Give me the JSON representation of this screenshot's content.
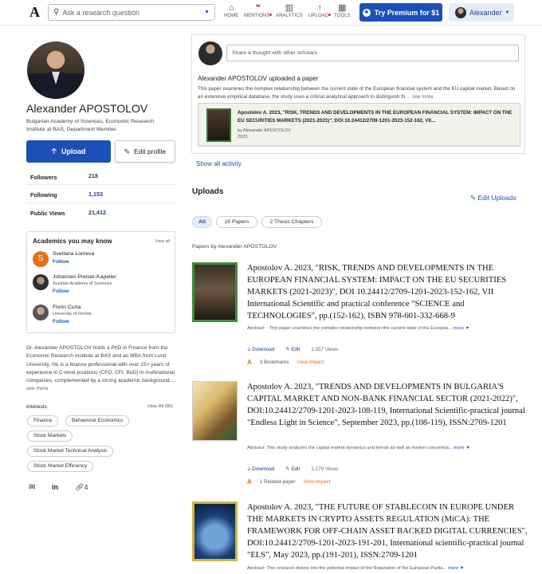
{
  "header": {
    "logo": "A",
    "search_placeholder": "Ask a research question",
    "nav": [
      {
        "label": "HOME",
        "icon": "home-icon",
        "glyph": "⌂"
      },
      {
        "label": "MENTIONS",
        "icon": "mentions-icon",
        "glyph": "❝"
      },
      {
        "label": "ANALYTICS",
        "icon": "analytics-icon",
        "glyph": "▥"
      },
      {
        "label": "UPLOAD",
        "icon": "upload-icon",
        "glyph": "↑"
      },
      {
        "label": "TOOLS",
        "icon": "tools-icon",
        "glyph": "▦"
      }
    ],
    "premium_label": "Try Premium for $1",
    "user_label": "Alexander"
  },
  "profile": {
    "name": "Alexander APOSTOLOV",
    "affiliation": "Bulgarian Academy of Sciences, Economic Research Institute at BAS, Department Member",
    "upload_label": "Upload",
    "edit_label": "Edit profile",
    "stats": [
      {
        "label": "Followers",
        "value": "218"
      },
      {
        "label": "Following",
        "value": "1,153"
      },
      {
        "label": "Public Views",
        "value": "21,412"
      }
    ]
  },
  "academics": {
    "title": "Academics you may know",
    "view_all": "View all",
    "people": [
      {
        "initial": "S",
        "name": "Svetlana Lomeva",
        "sub": "",
        "follow": "Follow"
      },
      {
        "initial": "",
        "name": "Johannes Preiser-Kapeller",
        "sub": "Austrian Academy of Sciences",
        "follow": "Follow"
      },
      {
        "initial": "",
        "name": "Florin Curta",
        "sub": "University of Florida",
        "follow": "Follow"
      }
    ]
  },
  "bio": {
    "text": "Dr. Alexander APOSTOLOV holds a PhD in Finance from the Economic Research Institute at BAS and an MBA from Lund University. He is a finance professional with over 15+ years of experience in C-level positions (CFO, CFI, BoD) in multinational companies, complemented by a strong academic background....",
    "more": "see more"
  },
  "interests": {
    "title": "Interests",
    "view_all": "View All (85)",
    "items": [
      "Finance",
      "Behavioral Economics",
      "Stock Markets",
      "Stock Market Technical Analysis",
      "Stock Market Efficiency"
    ]
  },
  "social": {
    "links_count": "4"
  },
  "activity": {
    "thought_placeholder": "Share a thought with other scholars",
    "title": "Alexander APOSTOLOV uploaded a paper",
    "description": "This paper examines the complex relationship between the current state of the European financial system and the EU capital market. Based on an extensive empirical database, the study uses a critical analytical approach to distinguish th",
    "more": "... see more",
    "card_title": "Apostolov A. 2023, \"RISK, TRENDS AND DEVELOPMENTS IN THE EUROPEAN FINANCIAL SYSTEM: IMPACT ON THE EU SECURITIES MARKETS (2021-2023)\", DOI 10.24412/2709-1201-2023-152-162, VII...",
    "card_by": "by Alexander APOSTOLOV",
    "card_year": "2023",
    "show_all": "Show all activity"
  },
  "uploads": {
    "title": "Uploads",
    "edit_label": "Edit Uploads",
    "filters": [
      "All",
      "15 Papers",
      "2 Thesis Chapters"
    ],
    "papers_by": "Papers by Alexander APOSTOLOV",
    "papers": [
      {
        "title": "Apostolov A. 2023, \"RISK, TRENDS AND DEVELOPMENTS IN THE EUROPEAN FINANCIAL SYSTEM: IMPACT ON THE EU SECURITIES MARKETS (2021-2023)\", DOI 10.24412/2709-1201-2023-152-162, VII International Scientific and practical conference \"SCIENCE and TECHNOLOGIES\", pp.(152-162), ISBN 978-601-332-668-9",
        "abstract": "Abstract: : This paper examines the complex relationship between the current state of the Europea...",
        "more": "more",
        "download": "Download",
        "edit": "Edit",
        "views": "1,057 Views",
        "meta": "3 Bookmarks",
        "impact": "View impact"
      },
      {
        "title": "Apostolov A. 2023, \"TRENDS AND DEVELOPMENTS IN BULGARIA'S CAPITAL MARKET AND NON-BANK FINANCIAL SECTOR (2021-2022)\", DOI:10.24412/2709-1201-2023-108-119, International Scientific-practical journal \"Endless Light in Science\", September 2023, pp.(108-119), ISSN:2709-1201",
        "abstract": "Abstract: This study analyzes the capital market dynamics and trends as well as market concentrat...",
        "more": "more",
        "download": "Download",
        "edit": "Edit",
        "views": "1,179 Views",
        "meta": "1 Related paper",
        "impact": "View impact"
      },
      {
        "title": "Apostolov A. 2023, \"THE FUTURE OF STABLECOIN IN EUROPE UNDER THE MARKETS IN CRYPTO ASSETS REGULATION (MiCA): THE FRAMEWORK FOR OFF-CHAIN ASSET BACKED DIGITAL CURRENCIES\", DOI:10.24412/2709-1201-2023-191-201, International scientific-practical journal \"ELS\", May 2023, pp.(191-201), ISSN:2709-1201",
        "abstract": "Abstract: This research delves into the potential impact of the Regulation of the European Parlia...",
        "more": "more"
      }
    ]
  },
  "colors": {
    "brand": "#1d4fb8",
    "link": "#1d58c9",
    "accent": "#e4720e",
    "chip_selected": "#e4ecfa"
  }
}
